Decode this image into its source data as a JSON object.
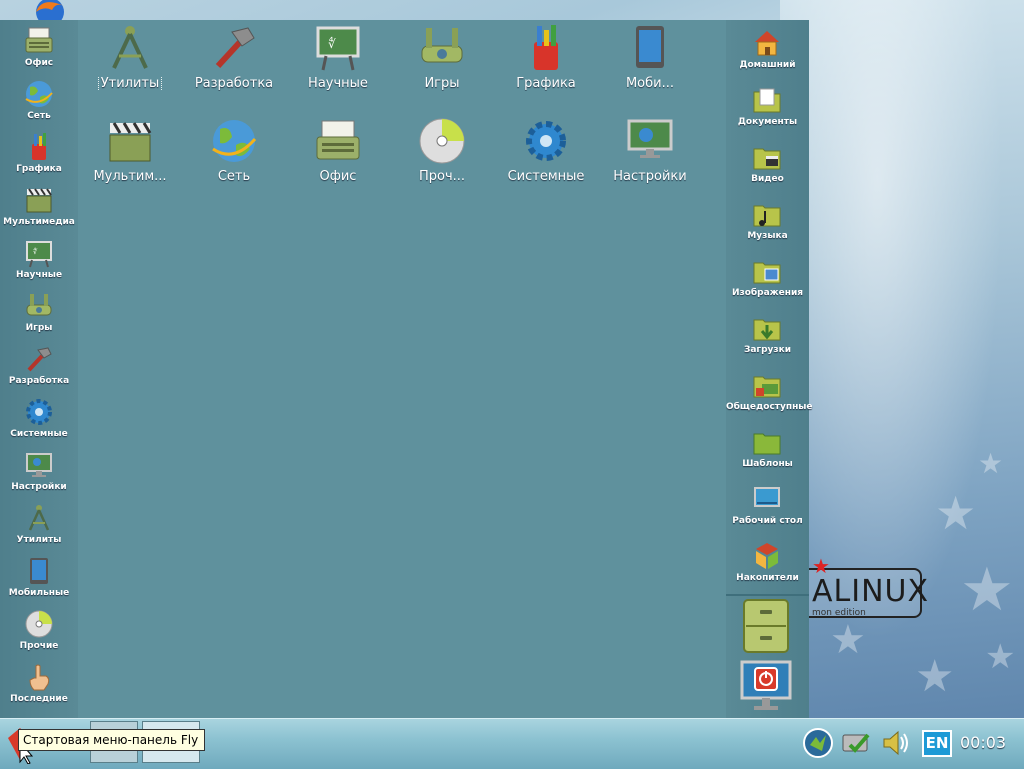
{
  "wallpaper": {
    "logo_text": "ALINUX",
    "logo_subtext": "mon edition"
  },
  "left_column": {
    "items": [
      {
        "label": "Офис",
        "icon": "typewriter-icon"
      },
      {
        "label": "Сеть",
        "icon": "globe-icon"
      },
      {
        "label": "Графика",
        "icon": "paint-brushes-icon"
      },
      {
        "label": "Мультимедиа",
        "icon": "clapperboard-icon"
      },
      {
        "label": "Научные",
        "icon": "chalkboard-icon"
      },
      {
        "label": "Игры",
        "icon": "joystick-icon"
      },
      {
        "label": "Разработка",
        "icon": "hammer-icon"
      },
      {
        "label": "Системные",
        "icon": "gear-icon"
      },
      {
        "label": "Настройки",
        "icon": "monitor-settings-icon"
      },
      {
        "label": "Утилиты",
        "icon": "compass-icon"
      },
      {
        "label": "Мобильные",
        "icon": "tablet-icon"
      },
      {
        "label": "Прочие",
        "icon": "cd-icon"
      },
      {
        "label": "Последние",
        "icon": "hand-icon"
      }
    ]
  },
  "center_grid": {
    "items": [
      {
        "label": "Утилиты",
        "icon": "compass-icon",
        "selected": true
      },
      {
        "label": "Разработка",
        "icon": "hammer-icon"
      },
      {
        "label": "Научные",
        "icon": "chalkboard-icon"
      },
      {
        "label": "Игры",
        "icon": "joystick-icon"
      },
      {
        "label": "Графика",
        "icon": "paint-brushes-icon"
      },
      {
        "label": "Моби...",
        "icon": "tablet-icon"
      },
      {
        "label": "Мультим...",
        "icon": "clapperboard-icon"
      },
      {
        "label": "Сеть",
        "icon": "globe-icon"
      },
      {
        "label": "Офис",
        "icon": "typewriter-icon"
      },
      {
        "label": "Проч...",
        "icon": "cd-icon"
      },
      {
        "label": "Системные",
        "icon": "gear-icon"
      },
      {
        "label": "Настройки",
        "icon": "monitor-settings-icon"
      }
    ]
  },
  "right_column": {
    "items": [
      {
        "label": "Домашний",
        "icon": "home-icon"
      },
      {
        "label": "Документы",
        "icon": "folder-documents-icon"
      },
      {
        "label": "Видео",
        "icon": "folder-video-icon"
      },
      {
        "label": "Музыка",
        "icon": "folder-music-icon"
      },
      {
        "label": "Изображения",
        "icon": "folder-images-icon"
      },
      {
        "label": "Загрузки",
        "icon": "folder-downloads-icon"
      },
      {
        "label": "Общедоступные",
        "icon": "folder-public-icon"
      },
      {
        "label": "Шаблоны",
        "icon": "folder-templates-icon"
      },
      {
        "label": "Рабочий стол",
        "icon": "desktop-icon"
      },
      {
        "label": "Накопители",
        "icon": "drives-icon"
      }
    ],
    "bottom_buttons": [
      {
        "icon": "file-cabinet-icon"
      },
      {
        "icon": "power-icon"
      }
    ]
  },
  "taskbar": {
    "tooltip": "Стартовая меню-панель Fly",
    "language": "EN",
    "clock": "00:03",
    "colors": {
      "accent": "#1e9ad6",
      "panel": "#5f919d"
    }
  }
}
